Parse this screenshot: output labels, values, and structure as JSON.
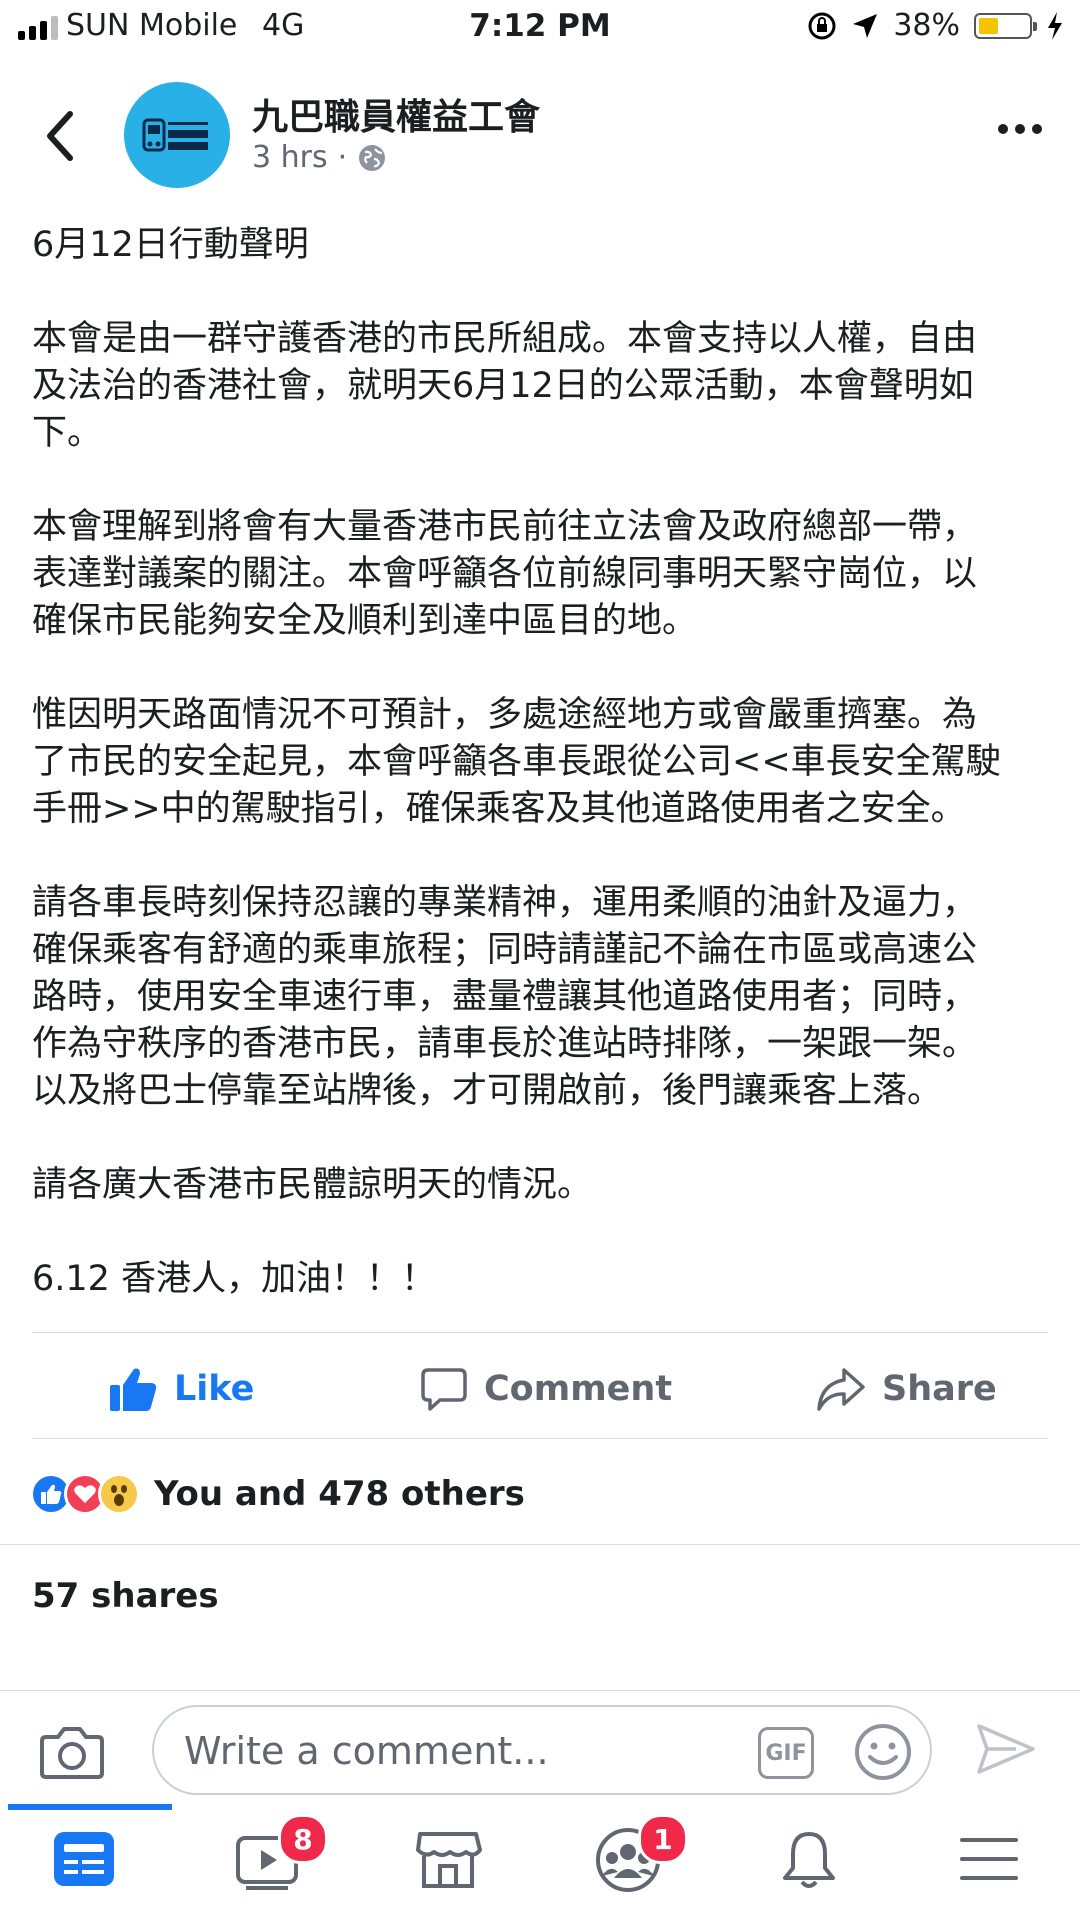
{
  "status_bar": {
    "carrier": "SUN Mobile",
    "network": "4G",
    "time": "7:12 PM",
    "battery_percent": "38%",
    "battery_level": 0.38
  },
  "post": {
    "page_name": "九巴職員權益工會",
    "time_ago": "3 hrs",
    "dot": "·",
    "paragraphs": [
      "6月12日行動聲明",
      "本會是由一群守護香港的市民所組成。本會支持以人權，自由\n及法治的香港社會，就明天6月12日的公眾活動，本會聲明如\n下。",
      "本會理解到將會有大量香港市民前往立法會及政府總部一帶，\n表達對議案的關注。本會呼籲各位前線同事明天緊守崗位，以\n確保市民能夠安全及順利到達中區目的地。",
      "惟因明天路面情況不可預計，多處途經地方或會嚴重擠塞。為\n了市民的安全起見，本會呼籲各車長跟從公司<<車長安全駕駛\n手冊>>中的駕駛指引，確保乘客及其他道路使用者之安全。",
      "請各車長時刻保持忍讓的專業精神，運用柔順的油針及逼力，\n確保乘客有舒適的乘車旅程；同時請謹記不論在市區或高速公\n路時，使用安全車速行車，盡量禮讓其他道路使用者；同時，\n作為守秩序的香港市民，請車長於進站時排隊，一架跟一架。\n以及將巴士停靠至站牌後，才可開啟前，後門讓乘客上落。",
      "請各廣大香港市民體諒明天的情況。",
      "6.12 香港人，加油！！！"
    ]
  },
  "actions": {
    "like": "Like",
    "comment": "Comment",
    "share": "Share"
  },
  "reactions": {
    "text": "You and 478 others"
  },
  "shares": "57 shares",
  "comment_bar": {
    "placeholder": "Write a comment...",
    "gif": "GIF"
  },
  "tabbar": {
    "video_badge": "8",
    "groups_badge": "1"
  },
  "colors": {
    "accent": "#1877f2",
    "badge": "#f02849",
    "avatar": "#29b0e6"
  }
}
